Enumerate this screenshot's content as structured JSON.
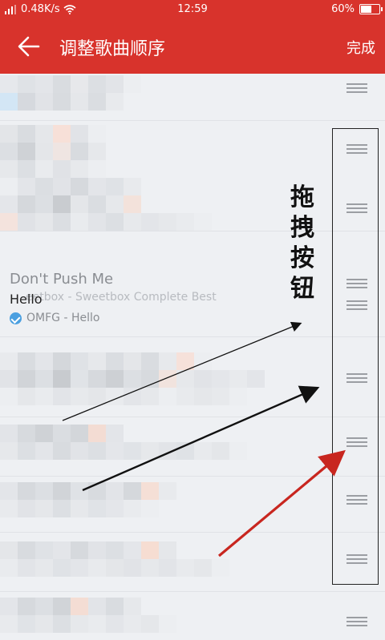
{
  "status_bar": {
    "speed": "0.48K/s",
    "time": "12:59",
    "battery": "60%",
    "battery_level": 0.6
  },
  "header": {
    "title": "调整歌曲顺序",
    "done_label": "完成"
  },
  "dragging_song": {
    "title": "Don't Push Me",
    "subtitle": "Sweetbox - Sweetbox Complete Best",
    "subtitle_visible": "eetbox - Sweetbox Complete Best",
    "drag_title": "Hello",
    "drag_subtitle": "OMFG - Hello"
  },
  "annotation": {
    "text": "拖拽按钮"
  },
  "colors": {
    "header": "#d8332c",
    "check": "#4a9fe0",
    "arrow_red": "#c8261f"
  }
}
